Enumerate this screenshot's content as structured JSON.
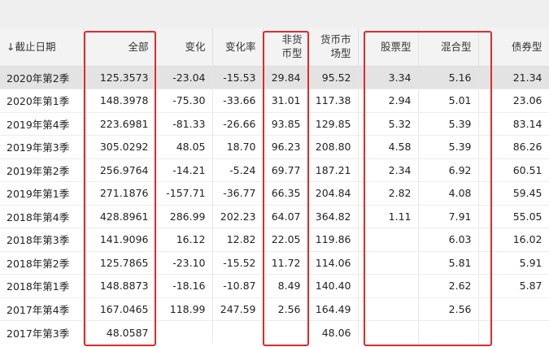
{
  "headers": {
    "date": "↓截止日期",
    "total": "全部",
    "change": "变化",
    "change_rate": "变化率",
    "non_money": "非货\n币型",
    "money": "货币市\n场型",
    "stock": "股票型",
    "mixed": "混合型",
    "bond": "债券型"
  },
  "rows": [
    {
      "date": "2020年第2季",
      "total": "125.3573",
      "change": "-23.04",
      "change_rate": "-15.53",
      "non_money": "29.84",
      "money": "95.52",
      "stock": "3.34",
      "mixed": "5.16",
      "bond": "21.34"
    },
    {
      "date": "2020年第1季",
      "total": "148.3978",
      "change": "-75.30",
      "change_rate": "-33.66",
      "non_money": "31.01",
      "money": "117.38",
      "stock": "2.94",
      "mixed": "5.01",
      "bond": "23.06"
    },
    {
      "date": "2019年第4季",
      "total": "223.6981",
      "change": "-81.33",
      "change_rate": "-26.66",
      "non_money": "93.85",
      "money": "129.85",
      "stock": "5.32",
      "mixed": "5.39",
      "bond": "83.14"
    },
    {
      "date": "2019年第3季",
      "total": "305.0292",
      "change": "48.05",
      "change_rate": "18.70",
      "non_money": "96.23",
      "money": "208.80",
      "stock": "4.58",
      "mixed": "5.39",
      "bond": "86.26"
    },
    {
      "date": "2019年第2季",
      "total": "256.9764",
      "change": "-14.21",
      "change_rate": "-5.24",
      "non_money": "69.77",
      "money": "187.21",
      "stock": "2.34",
      "mixed": "6.92",
      "bond": "60.51"
    },
    {
      "date": "2019年第1季",
      "total": "271.1876",
      "change": "-157.71",
      "change_rate": "-36.77",
      "non_money": "66.35",
      "money": "204.84",
      "stock": "2.82",
      "mixed": "4.08",
      "bond": "59.45"
    },
    {
      "date": "2018年第4季",
      "total": "428.8961",
      "change": "286.99",
      "change_rate": "202.23",
      "non_money": "64.07",
      "money": "364.82",
      "stock": "1.11",
      "mixed": "7.91",
      "bond": "55.05"
    },
    {
      "date": "2018年第3季",
      "total": "141.9096",
      "change": "16.12",
      "change_rate": "12.82",
      "non_money": "22.05",
      "money": "119.86",
      "stock": "",
      "mixed": "6.03",
      "bond": "16.02"
    },
    {
      "date": "2018年第2季",
      "total": "125.7865",
      "change": "-23.10",
      "change_rate": "-15.52",
      "non_money": "11.72",
      "money": "114.06",
      "stock": "",
      "mixed": "5.81",
      "bond": "5.91"
    },
    {
      "date": "2018年第1季",
      "total": "148.8873",
      "change": "-18.16",
      "change_rate": "-10.87",
      "non_money": "8.49",
      "money": "140.40",
      "stock": "",
      "mixed": "2.62",
      "bond": "5.87"
    },
    {
      "date": "2017年第4季",
      "total": "167.0465",
      "change": "118.99",
      "change_rate": "247.59",
      "non_money": "2.56",
      "money": "164.49",
      "stock": "",
      "mixed": "2.56",
      "bond": ""
    },
    {
      "date": "2017年第3季",
      "total": "48.0587",
      "change": "",
      "change_rate": "",
      "non_money": "",
      "money": "48.06",
      "stock": "",
      "mixed": "",
      "bond": ""
    }
  ],
  "highlight_color": "#e02a2a"
}
